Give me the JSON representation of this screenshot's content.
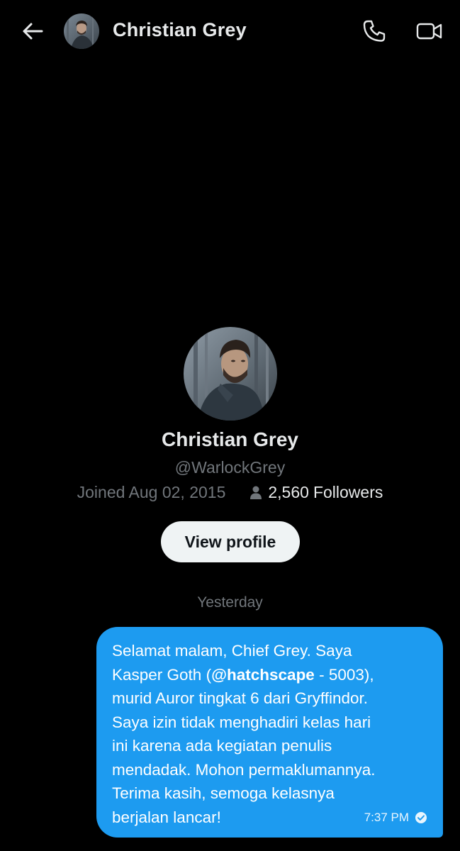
{
  "header": {
    "title": "Christian Grey",
    "back_icon": "arrow-left-icon",
    "call_icon": "phone-icon",
    "video_icon": "video-camera-icon"
  },
  "profile": {
    "name": "Christian Grey",
    "handle": "@WarlockGrey",
    "joined": "Joined Aug 02, 2015",
    "followers_count": "2,560",
    "followers_label": "Followers",
    "view_profile_label": "View profile"
  },
  "conversation": {
    "date_divider": "Yesterday",
    "messages": [
      {
        "text_before_mention": "Selamat malam, Chief Grey. Saya\nKasper Goth (",
        "mention": "@hatchscape",
        "text_after_mention": " - 5003),\nmurid Auror tingkat 6 dari Gryffindor.\nSaya izin tidak menghadiri kelas hari\nini karena ada kegiatan penulis\nmendadak. Mohon permaklumannya.\nTerima kasih, semoga kelasnya\nberjalan lancar!",
        "time": "7:37 PM",
        "status": "sent"
      }
    ]
  },
  "colors": {
    "background": "#000000",
    "bubble": "#1d9bf0",
    "muted_text": "#71767b",
    "primary_text": "#e7e9ea",
    "button_bg": "#eff3f4"
  }
}
